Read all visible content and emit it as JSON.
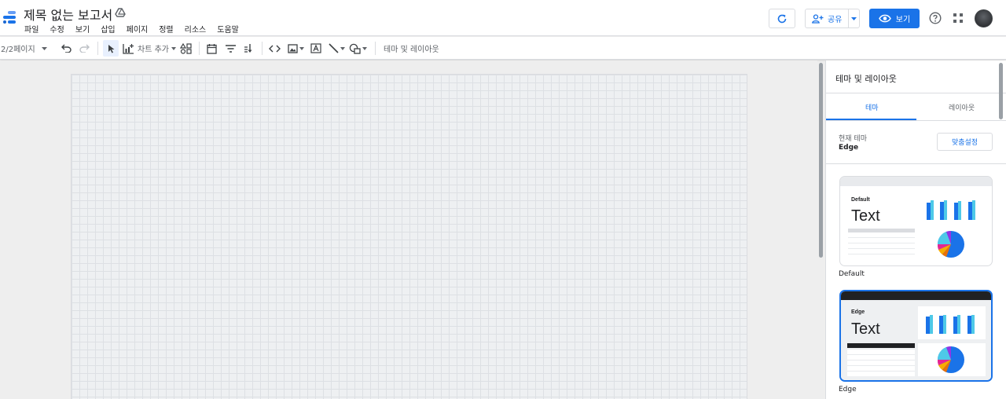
{
  "header": {
    "title": "제목 없는 보고서",
    "menu": [
      "파일",
      "수정",
      "보기",
      "삽입",
      "페이지",
      "정렬",
      "리소스",
      "도움말"
    ],
    "share_label": "공유",
    "view_label": "보기"
  },
  "toolbar": {
    "page_indicator": "2/2페이지",
    "add_chart_label": "차트 추가",
    "theme_layout_label": "테마 및 레이아웃"
  },
  "panel": {
    "title": "테마 및 레이아웃",
    "tabs": [
      "테마",
      "레이아웃"
    ],
    "current_theme_label": "현재 테마",
    "current_theme_value": "Edge",
    "customize_label": "맞춤설정",
    "themes": [
      {
        "name": "Default",
        "heading": "Default",
        "sample_text": "Text"
      },
      {
        "name": "Edge",
        "heading": "Edge",
        "sample_text": "Text"
      }
    ]
  },
  "colors": {
    "accent": "#1a73e8",
    "edge_header": "#202124",
    "bar_primary": "#1a73e8",
    "bar_secondary": "#4ec9e8"
  }
}
